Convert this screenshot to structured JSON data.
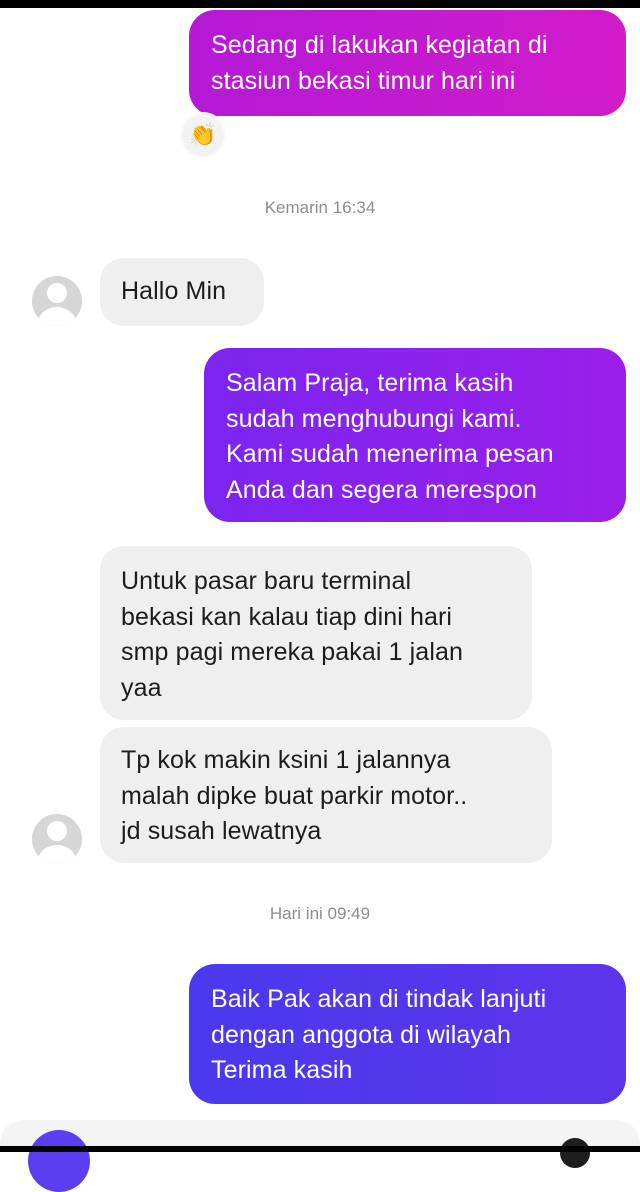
{
  "messages": {
    "m1": {
      "text": "Sedang di lakukan kegiatan di\nstasiun bekasi timur hari ini",
      "color": "#c61ed2"
    },
    "reaction": {
      "emoji": "👏",
      "icon": "clapping-hands-icon"
    },
    "ts1": "Kemarin 16:34",
    "m2": "Hallo Min",
    "m3": {
      "text": "Salam Praja, terima kasih\nsudah menghubungi kami.\nKami sudah menerima pesan\nAnda dan segera merespon",
      "color": "#9020ef"
    },
    "m4": "Untuk pasar baru terminal\nbekasi kan kalau tiap dini hari\nsmp pagi mereka pakai 1 jalan\nyaa",
    "m5": "Tp kok makin ksini 1 jalannya\nmalah dipke buat parkir motor..\njd susah lewatnya",
    "ts2": "Hari ini 09:49",
    "m6": {
      "text": "Baik Pak akan di tindak lanjuti\ndengan anggota di wilayah\nTerima kasih",
      "color": "#5a35ee"
    }
  }
}
